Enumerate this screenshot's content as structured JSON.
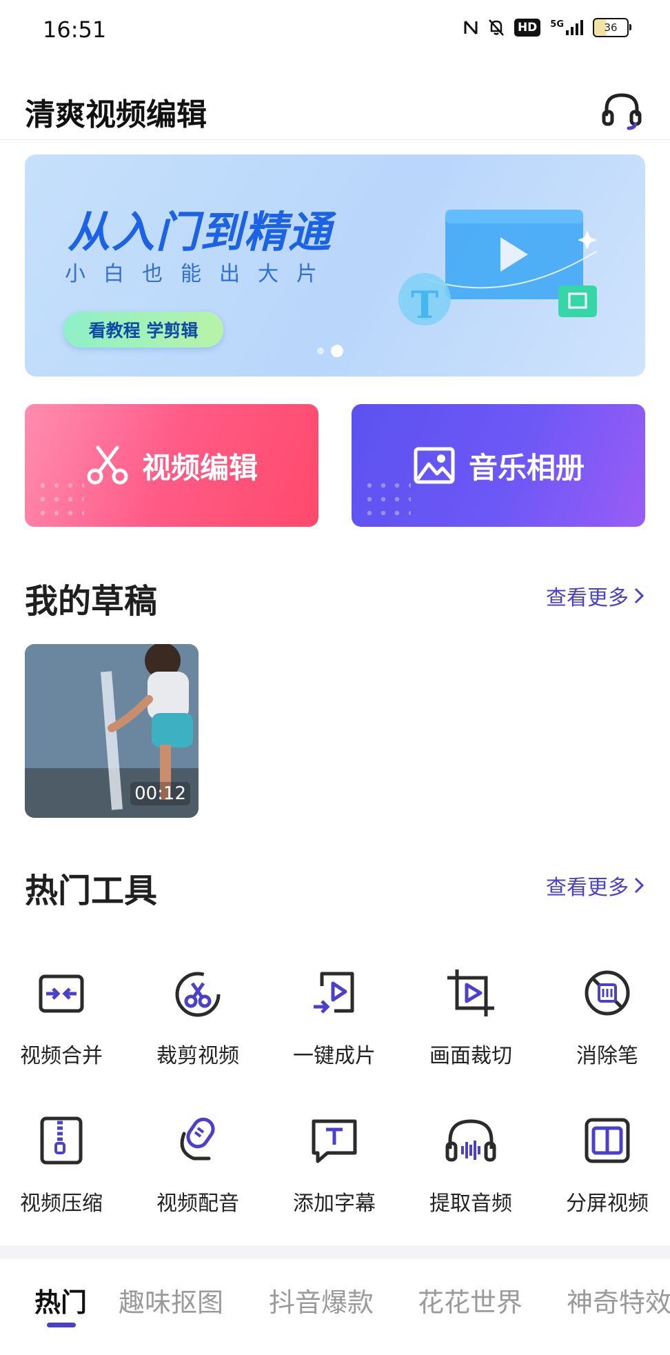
{
  "status_bar": {
    "time": "16:51",
    "network": "5G",
    "hd_label": "HD",
    "battery": "36"
  },
  "header": {
    "title": "清爽视频编辑",
    "support_icon": "headset-icon"
  },
  "banner": {
    "headline": "从入门到精通",
    "subtitle": "小白也能出大片",
    "cta": "看教程 学剪辑",
    "art_letter": "T",
    "carousel_count": 2,
    "carousel_active": 2
  },
  "quick_actions": [
    {
      "label": "视频编辑",
      "icon": "scissors-icon",
      "color": "#ff5a86"
    },
    {
      "label": "音乐相册",
      "icon": "image-icon",
      "color": "#6a56f4"
    }
  ],
  "drafts": {
    "title": "我的草稿",
    "more": "查看更多",
    "items": [
      {
        "duration": "00:12"
      }
    ]
  },
  "tools": {
    "title": "热门工具",
    "more": "查看更多",
    "accent": "#4a40c9",
    "items": [
      {
        "label": "视频合并",
        "icon": "merge-icon"
      },
      {
        "label": "裁剪视频",
        "icon": "scissors-circle-icon"
      },
      {
        "label": "一键成片",
        "icon": "auto-video-icon"
      },
      {
        "label": "画面裁切",
        "icon": "crop-icon"
      },
      {
        "label": "消除笔",
        "icon": "eraser-stamp-icon"
      },
      {
        "label": "视频压缩",
        "icon": "compress-icon"
      },
      {
        "label": "视频配音",
        "icon": "microphone-icon"
      },
      {
        "label": "添加字幕",
        "icon": "subtitle-icon"
      },
      {
        "label": "提取音频",
        "icon": "headphones-icon"
      },
      {
        "label": "分屏视频",
        "icon": "split-screen-icon"
      }
    ]
  },
  "bottom_tabs": {
    "active_index": 0,
    "items": [
      "热门",
      "趣味抠图",
      "抖音爆款",
      "花花世界",
      "神奇特效"
    ]
  }
}
